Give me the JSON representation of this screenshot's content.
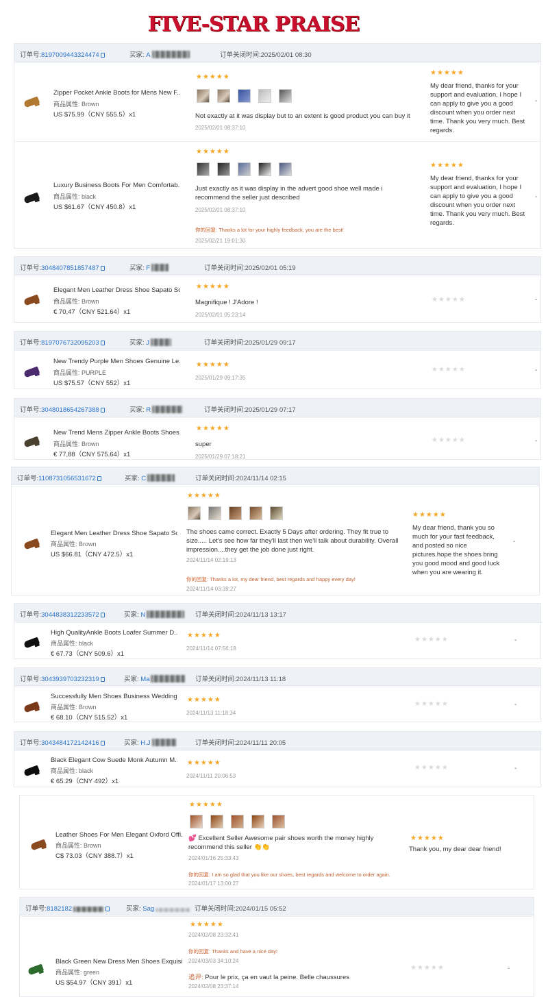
{
  "banner": {
    "title": "FIVE-STAR PRAISE"
  },
  "labels": {
    "order_no": "订单号:",
    "buyer": "买家:",
    "close_time": "订单关闭时间:",
    "attr": "商品属性:",
    "your_reply": "你的回复:",
    "dash": "-"
  },
  "orders": [
    {
      "order_no": "8197009443324474",
      "buyer": "A",
      "close_time": "2025/02/01 08:30",
      "items": [
        {
          "name": "Zipper Pocket Ankle Boots for Mens New F...",
          "attr": "Brown",
          "price": "US $75.99（CNY 555.5）x1",
          "stars": "★★★★★",
          "text": "Not exactly at it was display but to an extent is good product you can buy it",
          "time": "2025/02/01 08:37:10",
          "seller_stars": "★★★★★",
          "seller_reply": "My dear friend, thanks for your support and evaluation, I hope I can apply to give you a good discount when you order next time. Thank you very much. Best regards."
        },
        {
          "name": "Luxury Business Boots For Men Comfortab...",
          "attr": "black",
          "price": "US $61.67（CNY 450.8）x1",
          "stars": "★★★★★",
          "text": "Just exactly as it was display in the advert good shoe well made i recommend the seller just described",
          "time": "2025/02/01 08:37:10",
          "reply": "Thanks a lot for your highly feedback, you are the best!",
          "reply_time": "2025/02/21 19:01:30",
          "seller_stars": "★★★★★",
          "seller_reply": "My dear friend, thanks for your support and evaluation, I hope I can apply to give you a good discount when you order next time. Thank you very much. Best regards."
        }
      ]
    },
    {
      "order_no": "3048407851857487",
      "buyer": "F",
      "close_time": "2025/02/01 05:19",
      "items": [
        {
          "name": "Elegant Men Leather Dress Shoe Sapato So...",
          "attr": "Brown",
          "price": "€ 70,47（CNY 521.64）x1",
          "stars": "★★★★★",
          "text": "Magnifique ! J'Adore !",
          "time": "2025/02/01 05:23:14",
          "seller_stars": "★★★★★"
        }
      ]
    },
    {
      "order_no": "8197076732095203",
      "buyer": "J",
      "close_time": "2025/01/29 09:17",
      "items": [
        {
          "name": "New Trendy Purple Men Shoes Genuine Le...",
          "attr": "PURPLE",
          "price": "US $75.57（CNY 552）x1",
          "stars": "★★★★★",
          "time": "2025/01/29 09:17:35",
          "seller_stars": "★★★★★"
        }
      ]
    },
    {
      "order_no": "3048018654267388",
      "buyer": "R",
      "close_time": "2025/01/29 07:17",
      "items": [
        {
          "name": "New Trend Mens Zipper Ankle Boots Shoes...",
          "attr": "Brown",
          "price": "€ 77,88（CNY 575.64）x1",
          "stars": "★★★★★",
          "text": "super",
          "time": "2025/01/29 07:18:21",
          "seller_stars": "★★★★★"
        }
      ]
    },
    {
      "order_no": "1108731056531672",
      "buyer": "C",
      "close_time": "2024/11/14 02:15",
      "items": [
        {
          "name": "Elegant Men Leather Dress Shoe Sapato So...",
          "attr": "Brown",
          "price": "US $66.81（CNY 472.5）x1",
          "stars": "★★★★★",
          "text": "The shoes came correct. Exactly 5 Days after ordering. They fit true to size..... Let's see how far they'll last then we'll talk about durability. Overall impression....they get the job done just right.",
          "time": "2024/11/14 02:19:13",
          "reply": "Thanks a lot, my dear friend, best regards and happy every day!",
          "reply_time": "2024/11/14 03:39:27",
          "seller_stars": "★★★★★",
          "seller_reply": "My dear friend, thank you so much for your fast feedback, and posted so nice pictures.hope the shoes bring you good mood and good luck when you are wearing it."
        }
      ]
    },
    {
      "order_no": "3044838312233572",
      "buyer": "N",
      "close_time": "2024/11/13 13:17",
      "items": [
        {
          "name": "High QualityAnkle Boots Loafer Summer D...",
          "attr": "black",
          "price": "€ 67.73（CNY 509.6）x1",
          "stars": "★★★★★",
          "time": "2024/11/14 07:56:18",
          "seller_stars": "★★★★★"
        }
      ]
    },
    {
      "order_no": "3043939703232319",
      "buyer": "Ma",
      "close_time": "2024/11/13 11:18",
      "items": [
        {
          "name": "Successfully Men Shoes Business Wedding ...",
          "attr": "Brown",
          "price": "€ 68.10（CNY 515.52）x1",
          "stars": "★★★★★",
          "time": "2024/11/13 11:18:34",
          "seller_stars": "★★★★★"
        }
      ]
    },
    {
      "order_no": "3043484172142416",
      "buyer": "H.J",
      "close_time": "2024/11/11 20:05",
      "items": [
        {
          "name": "Black Elegant Cow Suede Monk Autumn M...",
          "attr": "black",
          "price": "€ 65.29（CNY 492）x1",
          "stars": "★★★★★",
          "time": "2024/11/11 20:06:53",
          "seller_stars": "★★★★★"
        }
      ]
    },
    {
      "order_no": "",
      "items": [
        {
          "name": "Leather Shoes For Men Elegant Oxford Offi...",
          "attr": "Brown",
          "price": "C$ 73.03（CNY 388.7）x1",
          "stars": "★★★★★",
          "text": "💕 Excellent Seller Awesome pair shoes worth the money highly recommend this seller 👏👏",
          "time": "2024/01/16 25:33:43",
          "reply": "I am so glad that you like our shoes, best regards and welcome to order again.",
          "reply_time": "2024/01/17 13:00:27",
          "seller_stars": "★★★★★",
          "seller_reply": "Thank you, my dear dear friend!"
        }
      ]
    },
    {
      "order_no": "8182182",
      "buyer": "Sag",
      "close_time": "2024/01/15 05:52",
      "items": [
        {
          "name": "Black Green New Dress Men Shoes Exquisi...",
          "attr": "green",
          "price": "US $54.97（CNY 391）x1",
          "stars": "★★★★★",
          "time": "2024/02/08 23:32:41",
          "reply": "Thanks and have a nice day!",
          "reply_time": "2024/03/03 34:10:24",
          "followup_label": "追评:",
          "followup": "Pour le prix, ça en vaut la peine. Belle chaussures",
          "followup_time": "2024/02/08 23:37:14",
          "seller_stars": "★★★★★"
        }
      ]
    }
  ],
  "colors": {
    "accent_link": "#2a73c9",
    "star": "#f5a623",
    "banner": "#c8102e",
    "header_bg": "#eef2f7"
  }
}
